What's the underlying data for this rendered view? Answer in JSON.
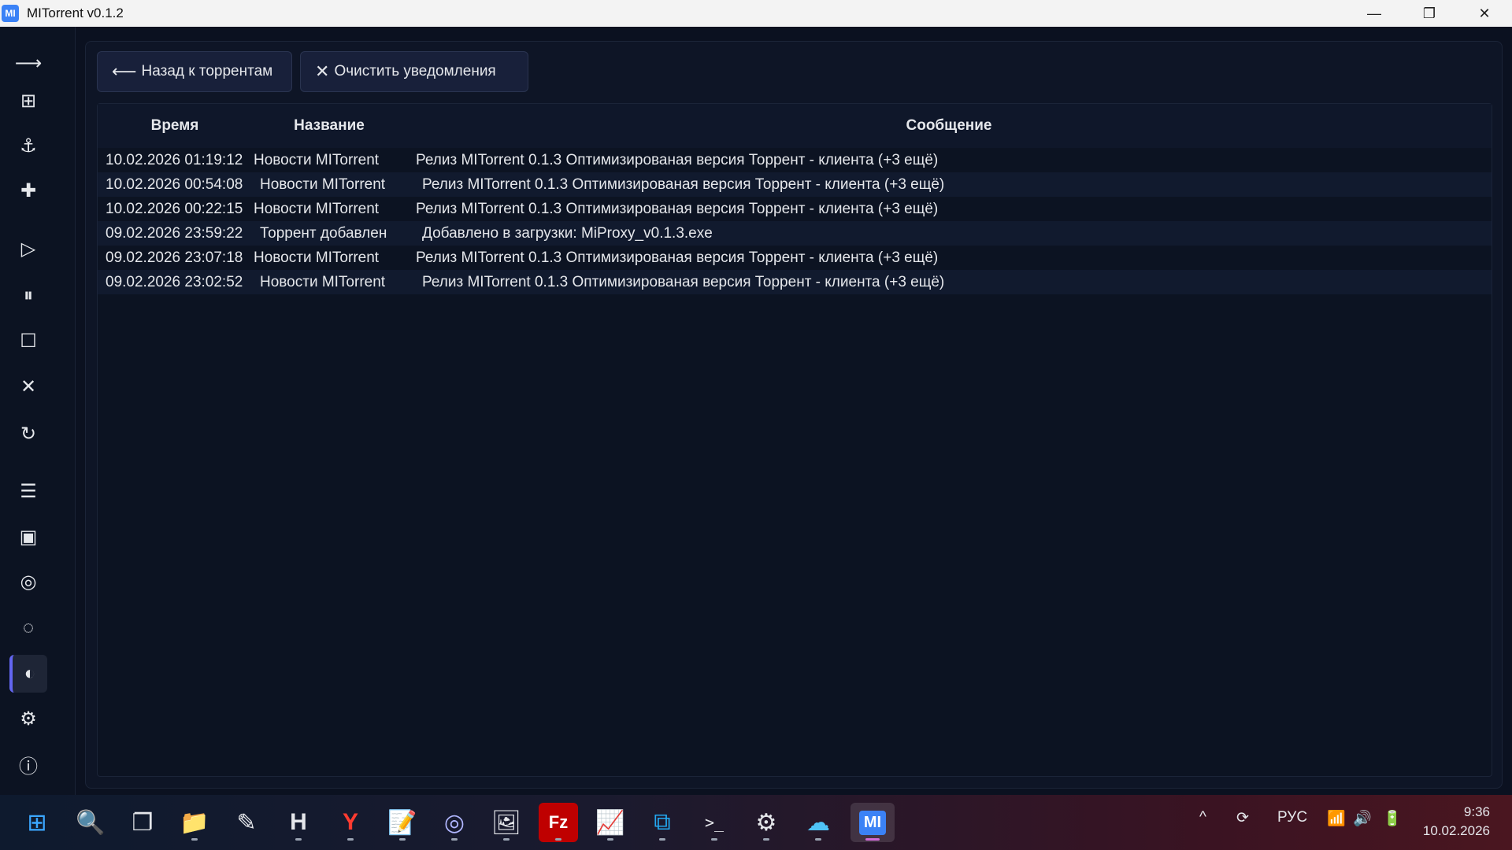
{
  "window": {
    "title": "MITorrent v0.1.2",
    "logo": "MI",
    "minimize": "—",
    "restore": "❐",
    "close": "✕"
  },
  "sidebar": {
    "icons": [
      {
        "name": "collapse-arrow-icon",
        "glyph": "⟶"
      },
      {
        "name": "grid-icon",
        "glyph": "⊞"
      },
      {
        "name": "anchor-icon",
        "glyph": "⚓"
      },
      {
        "name": "add-icon",
        "glyph": "✚"
      },
      {
        "name": "play-icon",
        "glyph": "▷"
      },
      {
        "name": "pause-icon",
        "glyph": "⏸"
      },
      {
        "name": "stop-icon",
        "glyph": "☐"
      },
      {
        "name": "remove-icon",
        "glyph": "✕"
      },
      {
        "name": "refresh-icon",
        "glyph": "↻"
      },
      {
        "name": "menu-icon",
        "glyph": "☰"
      },
      {
        "name": "window-icon",
        "glyph": "▣"
      },
      {
        "name": "target-icon",
        "glyph": "◎"
      },
      {
        "name": "loading-icon",
        "glyph": "◌"
      },
      {
        "name": "theme-icon",
        "glyph": "◐"
      },
      {
        "name": "settings-icon",
        "glyph": "⚙"
      },
      {
        "name": "info-icon",
        "glyph": "ⓘ"
      }
    ]
  },
  "toolbar": {
    "back_icon": "⟵",
    "back_label": "Назад к торрентам",
    "clear_icon": "✕",
    "clear_label": "Очистить уведомления"
  },
  "table": {
    "headers": {
      "time": "Время",
      "name": "Название",
      "message": "Сообщение"
    },
    "rows": [
      {
        "time": "10.02.2026 01:19:12",
        "name": "Новости MITorrent",
        "message": "Релиз MITorrent 0.1.3 Оптимизированая версия Торрент - клиента (+3 ещё)"
      },
      {
        "time": "10.02.2026 00:54:08",
        "name": "Новости MITorrent",
        "message": "Релиз MITorrent 0.1.3 Оптимизированая версия Торрент - клиента (+3 ещё)"
      },
      {
        "time": "10.02.2026 00:22:15",
        "name": "Новости MITorrent",
        "message": "Релиз MITorrent 0.1.3 Оптимизированая версия Торрент - клиента (+3 ещё)"
      },
      {
        "time": "09.02.2026 23:59:22",
        "name": "Торрент добавлен",
        "message": "Добавлено в загрузки: MiProxy_v0.1.3.exe"
      },
      {
        "time": "09.02.2026 23:07:18",
        "name": "Новости MITorrent",
        "message": "Релиз MITorrent 0.1.3 Оптимизированая версия Торрент - клиента (+3 ещё)"
      },
      {
        "time": "09.02.2026 23:02:52",
        "name": "Новости MITorrent",
        "message": "Релиз MITorrent 0.1.3 Оптимизированая версия Торрент - клиента (+3 ещё)"
      }
    ]
  },
  "taskbar": {
    "apps": [
      {
        "name": "start-icon",
        "glyph": "⊞"
      },
      {
        "name": "search-icon",
        "glyph": "🔍"
      },
      {
        "name": "task-view-icon",
        "glyph": "❐"
      },
      {
        "name": "file-explorer-icon",
        "glyph": "📁"
      },
      {
        "name": "pen-app-icon",
        "glyph": "✎"
      },
      {
        "name": "h-app-icon",
        "glyph": "H"
      },
      {
        "name": "yandex-browser-icon",
        "glyph": "Y"
      },
      {
        "name": "notepad-icon",
        "glyph": "📝"
      },
      {
        "name": "spiral-app-icon",
        "glyph": "◎"
      },
      {
        "name": "image-editor-icon",
        "glyph": "🖼"
      },
      {
        "name": "filezilla-icon",
        "glyph": "Fz"
      },
      {
        "name": "monitor-app-icon",
        "glyph": "📈"
      },
      {
        "name": "vscode-icon",
        "glyph": "⧉"
      },
      {
        "name": "terminal-icon",
        "glyph": ">_"
      },
      {
        "name": "settings-app-icon",
        "glyph": "⚙"
      },
      {
        "name": "network-app-icon",
        "glyph": "☁"
      },
      {
        "name": "mitorrent-app-icon",
        "glyph": "MI"
      }
    ],
    "tray": {
      "chevron": "^",
      "sync": "⟳",
      "lang": "РУС",
      "wifi": "📶",
      "volume": "🔊",
      "battery": "🔋"
    },
    "time": "9:36",
    "date": "10.02.2026"
  }
}
